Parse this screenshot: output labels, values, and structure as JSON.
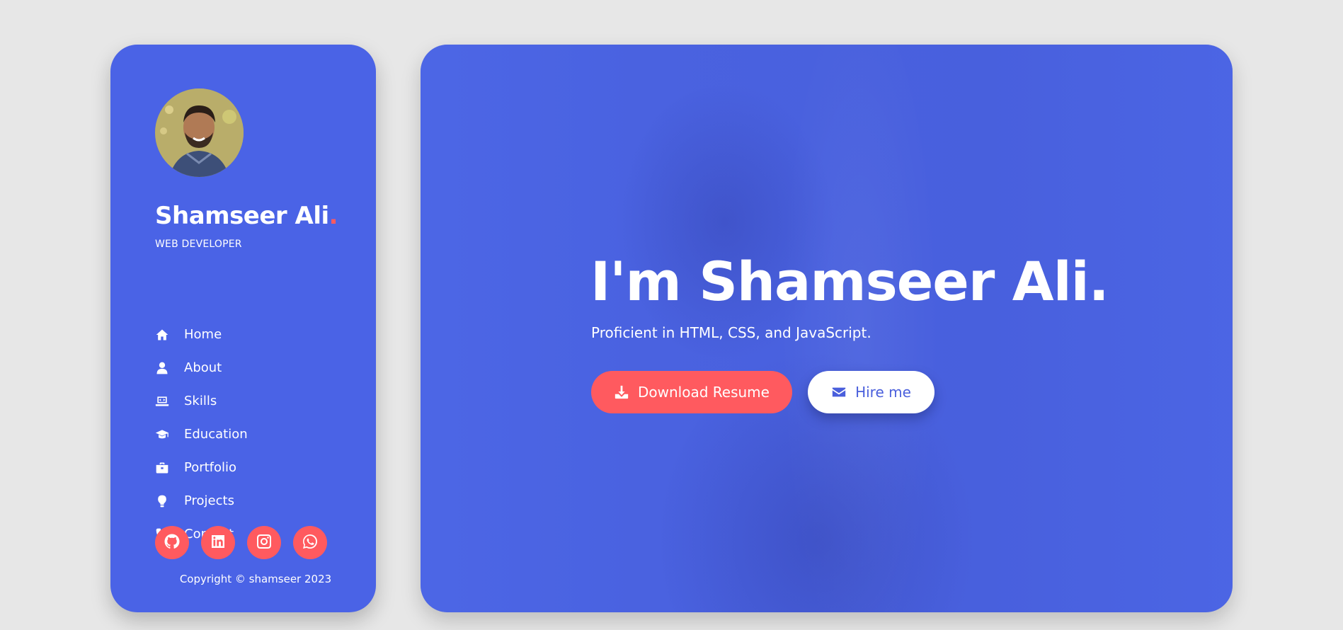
{
  "profile": {
    "name": "Shamseer Ali",
    "name_dot": ".",
    "role": "WEB DEVELOPER"
  },
  "nav": [
    {
      "label": "Home",
      "icon": "home-icon"
    },
    {
      "label": "About",
      "icon": "user-icon"
    },
    {
      "label": "Skills",
      "icon": "laptop-code-icon"
    },
    {
      "label": "Education",
      "icon": "graduation-cap-icon"
    },
    {
      "label": "Portfolio",
      "icon": "briefcase-icon"
    },
    {
      "label": "Projects",
      "icon": "lightbulb-icon"
    },
    {
      "label": "Contact",
      "icon": "phone-icon"
    }
  ],
  "socials": [
    {
      "name": "github",
      "icon": "github-icon"
    },
    {
      "name": "linkedin",
      "icon": "linkedin-icon"
    },
    {
      "name": "instagram",
      "icon": "instagram-icon"
    },
    {
      "name": "whatsapp",
      "icon": "whatsapp-icon"
    }
  ],
  "copyright": "Copyright © shamseer 2023",
  "hero": {
    "title": "I'm Shamseer Ali.",
    "subtitle": "Proficient in HTML, CSS, and JavaScript.",
    "primary_button": "Download Resume",
    "secondary_button": "Hire me"
  },
  "colors": {
    "accent": "#ff5a5f",
    "brand_blue": "#4a63e6",
    "background": "#e7e7e7"
  }
}
